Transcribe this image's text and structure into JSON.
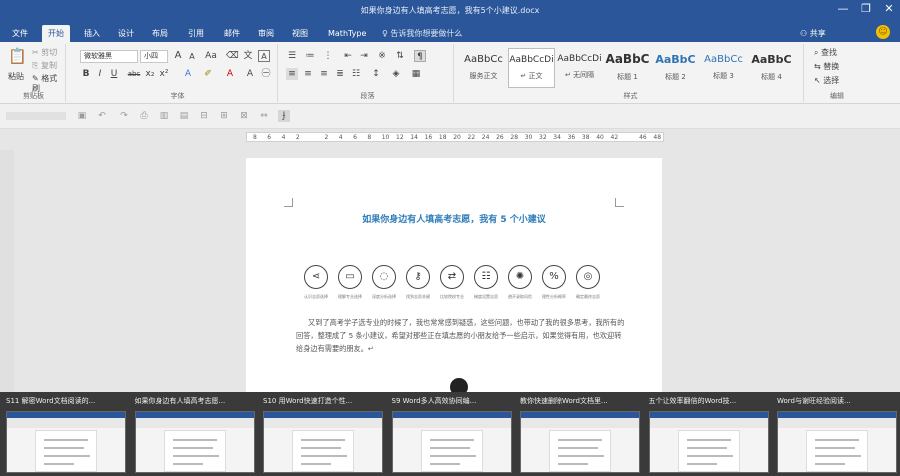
{
  "window": {
    "title": "如果你身边有人填高考志愿，我有5个小建议.docx",
    "controls": {
      "minimize": "—",
      "restore": "❐",
      "close": "✕"
    }
  },
  "tabs": [
    {
      "label": "文件"
    },
    {
      "label": "开始"
    },
    {
      "label": "插入"
    },
    {
      "label": "设计"
    },
    {
      "label": "布局"
    },
    {
      "label": "引用"
    },
    {
      "label": "邮件"
    },
    {
      "label": "审阅"
    },
    {
      "label": "视图"
    },
    {
      "label": "MathType"
    }
  ],
  "active_tab": "开始",
  "tell_me": "♀ 告诉我你想要做什么",
  "share": "共享",
  "ribbon": {
    "clipboard": {
      "paste": "粘贴",
      "cut": "剪切",
      "copy": "复制",
      "format_painter": "格式刷",
      "label": "剪贴板"
    },
    "font": {
      "name": "微软雅黑",
      "size": "小四",
      "grow": "A",
      "shrink": "A",
      "case": "Aa",
      "label": "字体",
      "bold": "B",
      "italic": "I",
      "underline": "U",
      "strike": "abc",
      "sub": "x₂",
      "sup": "x²"
    },
    "paragraph": {
      "label": "段落"
    },
    "styles": {
      "label": "样式",
      "items": [
        {
          "preview": "AaBbCc",
          "name": "服务正文"
        },
        {
          "preview": "AaBbCcDi",
          "name": "↵ 正文"
        },
        {
          "preview": "AaBbCcDi",
          "name": "↵ 无间隔"
        },
        {
          "preview": "AaBbC",
          "name": "标题 1"
        },
        {
          "preview": "AaBbC",
          "name": "标题 2"
        },
        {
          "preview": "AaBbCc",
          "name": "标题 3"
        },
        {
          "preview": "AaBbC",
          "name": "标题 4"
        }
      ]
    },
    "editing": {
      "find": "查找",
      "replace": "替换",
      "select": "选择",
      "label": "编辑"
    }
  },
  "ruler_numbers": [
    "8",
    "6",
    "4",
    "2",
    "",
    "2",
    "4",
    "6",
    "8",
    "10",
    "12",
    "14",
    "16",
    "18",
    "20",
    "22",
    "24",
    "26",
    "28",
    "30",
    "32",
    "34",
    "36",
    "38",
    "40",
    "42",
    "",
    "46",
    "48"
  ],
  "document": {
    "title": "如果你身边有人填高考志愿，我有 5 个小建议",
    "icons": [
      {
        "name": "share-icon",
        "glyph": "⋖",
        "label": "认识志愿选择"
      },
      {
        "name": "chat-icon",
        "glyph": "▭",
        "label": "理解专业选择"
      },
      {
        "name": "comment-icon",
        "glyph": "◌",
        "label": "深度分析选择"
      },
      {
        "name": "key-icon",
        "glyph": "⚷",
        "label": "找到志愿关键"
      },
      {
        "name": "swap-icon",
        "glyph": "⇄",
        "label": "比较院校专业"
      },
      {
        "name": "ladder-icon",
        "glyph": "☷",
        "label": "梯度设置志愿"
      },
      {
        "name": "virus-icon",
        "glyph": "✺",
        "label": "避开录取风险"
      },
      {
        "name": "percent-icon",
        "glyph": "%",
        "label": "理性分析概率"
      },
      {
        "name": "target-icon",
        "glyph": "◎",
        "label": "确定最终志愿"
      }
    ],
    "body": "又到了高考学子选专业的时候了，我也常常感到疑惑，这些问题，也带动了我的很多思考，我所有的回答，整理成了 5 条小建议，希望对那些正在填志愿的小朋友给予一些启示，如果觉得有用，也欢迎转给身边有需要的朋友。↵"
  },
  "taskbar": [
    {
      "title": "S11 解密Word文档阅读的..."
    },
    {
      "title": "如果你身边有人填高考志愿..."
    },
    {
      "title": "S10 用Word快速打造个性..."
    },
    {
      "title": "S9 Word多人高效协同编..."
    },
    {
      "title": "教你快速删除Word文档里..."
    },
    {
      "title": "五个让效率翻倍的Word技..."
    },
    {
      "title": "Word与谢旺经验阅读..."
    }
  ]
}
